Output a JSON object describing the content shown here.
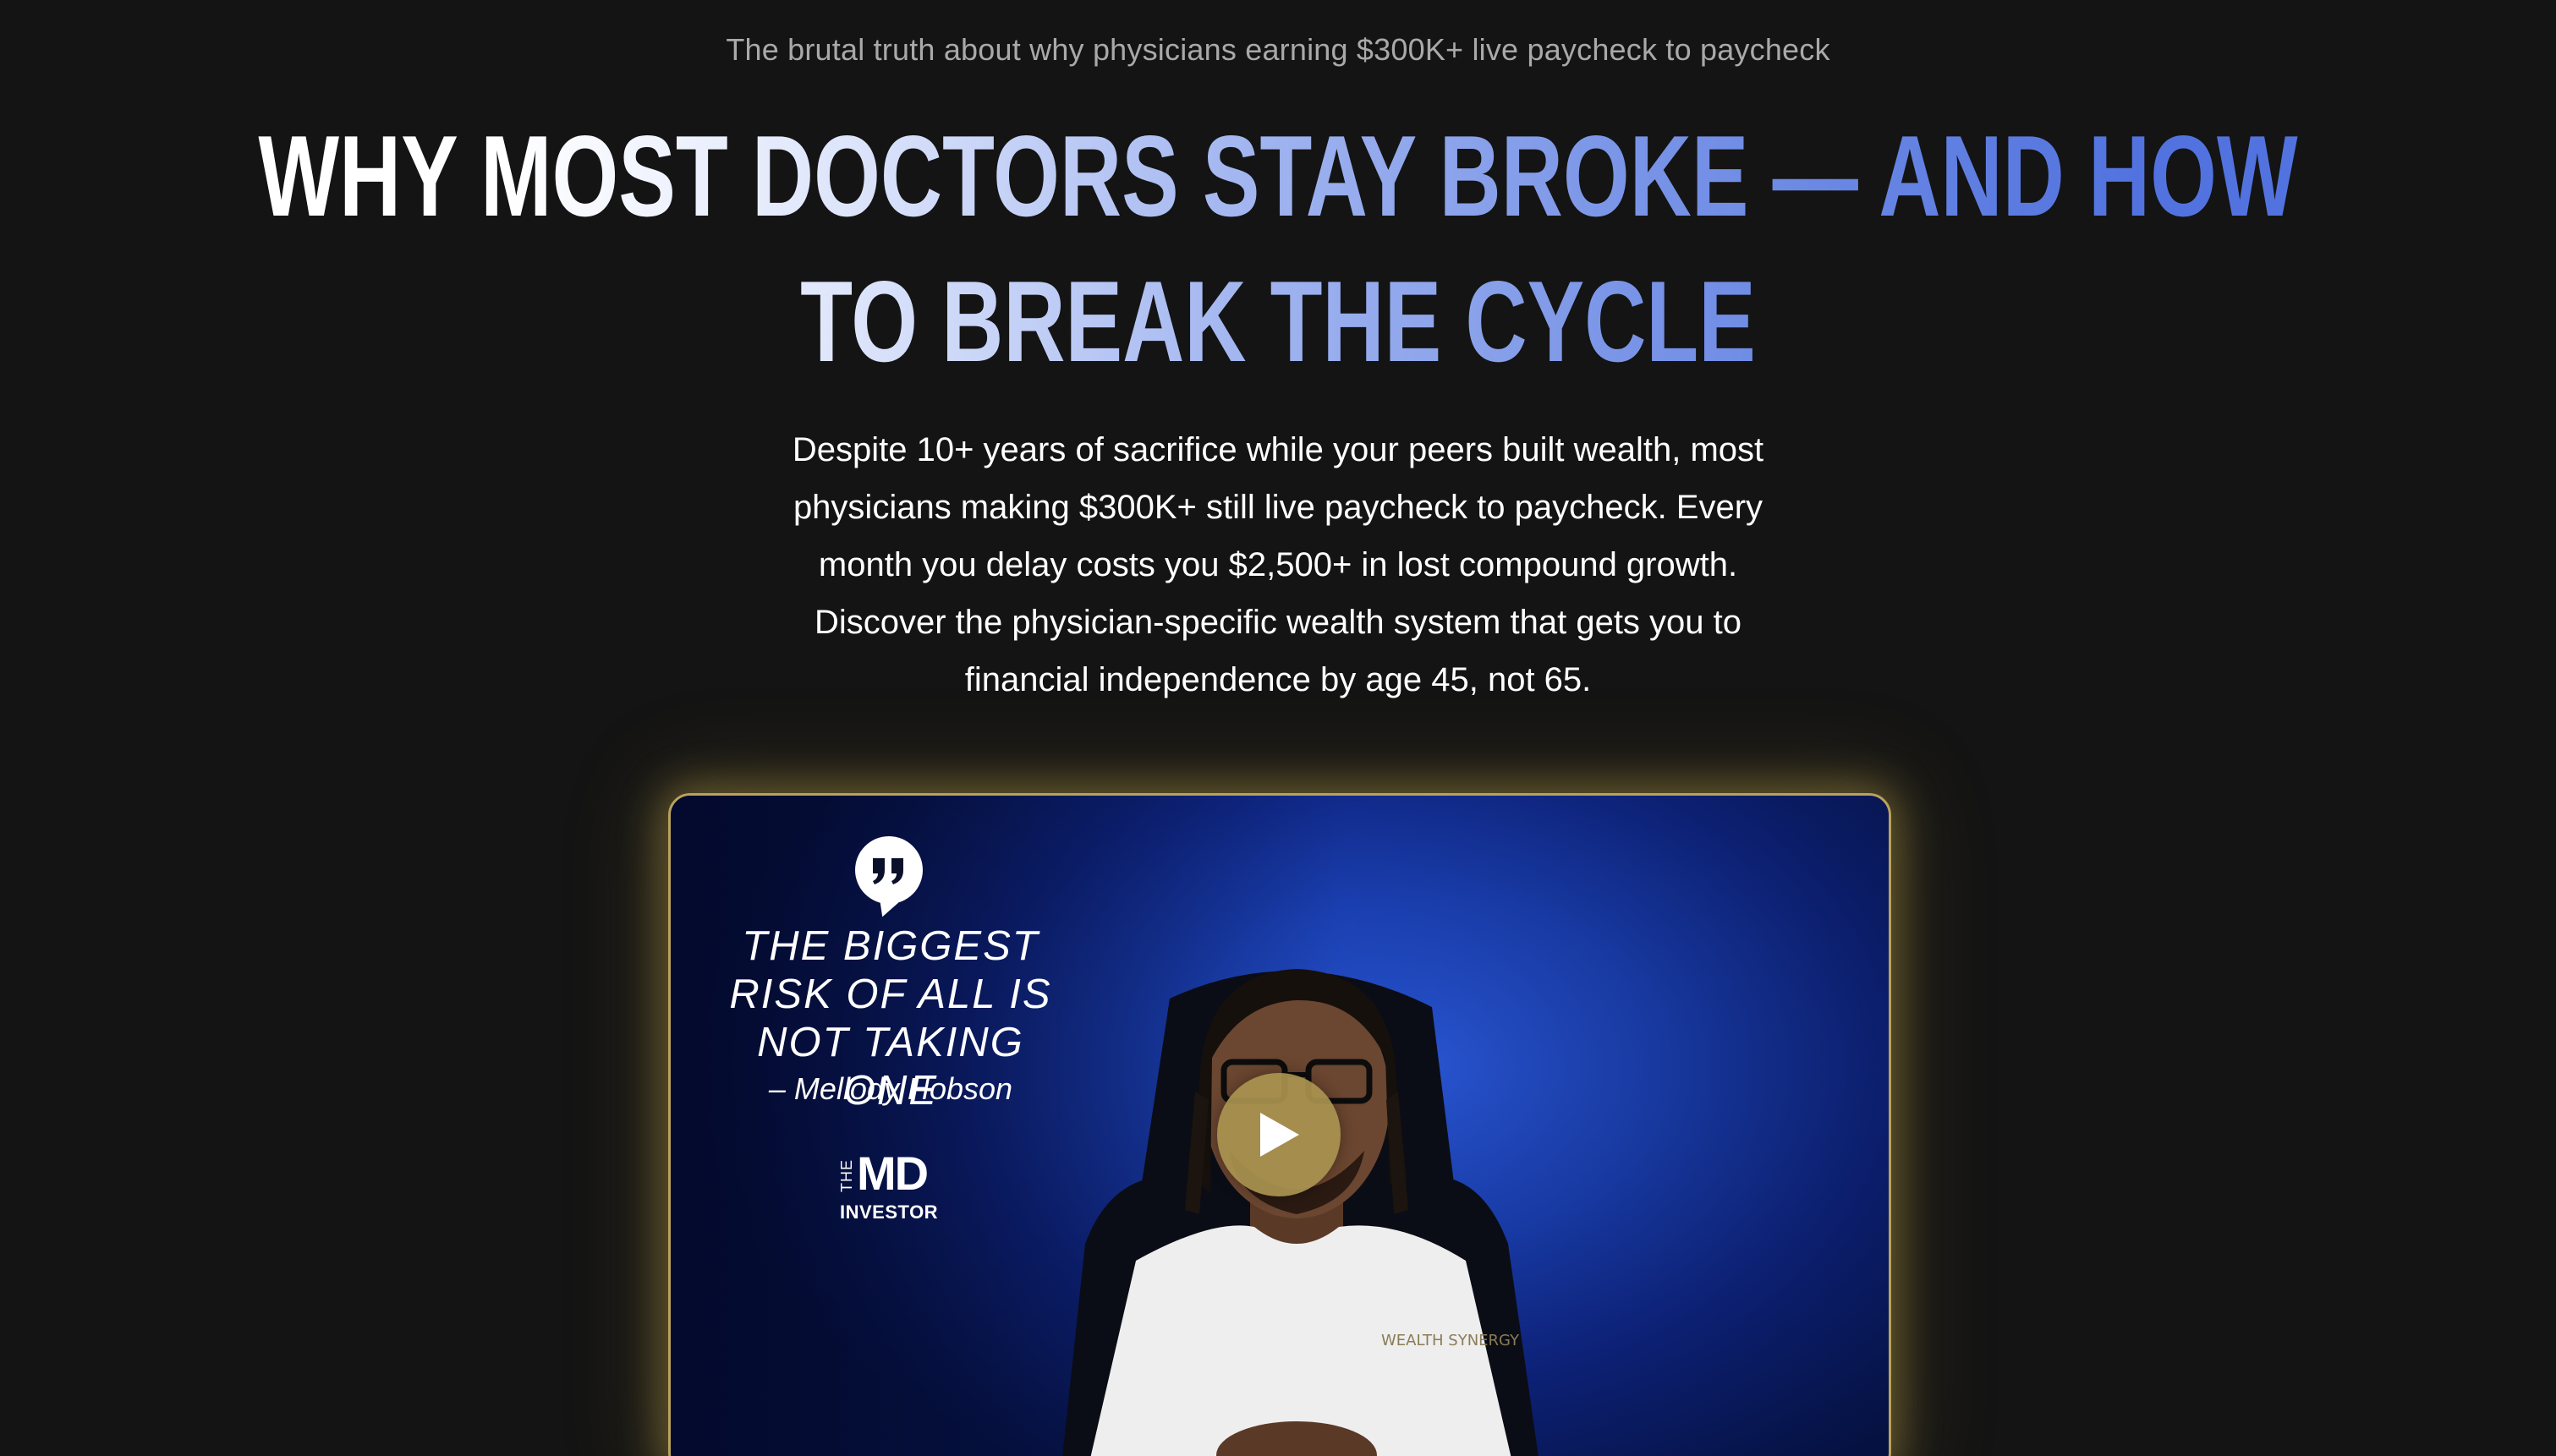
{
  "hero": {
    "eyebrow": "The brutal truth about why physicians earning $300K+ live paycheck to paycheck",
    "headline": "WHY MOST DOCTORS STAY BROKE — AND HOW TO BREAK THE CYCLE",
    "subtext": "Despite 10+ years of sacrifice while your peers built wealth, most physicians making $300K+ still live paycheck to paycheck. Every month you delay costs you $2,500+ in lost compound growth. Discover the physician-specific wealth system that gets you to financial independence by age 45, not 65."
  },
  "video": {
    "quote": "THE BIGGEST RISK OF ALL IS NOT TAKING ONE",
    "author": "– Mellody Hobson",
    "logo_the": "THE",
    "logo_md": "MD",
    "logo_investor": "INVESTOR",
    "shirt_text": "WEALTH SYNERGY",
    "play_icon": "play-icon",
    "quote_icon": "quote-icon"
  },
  "colors": {
    "background": "#141414",
    "headline_gradient_start": "#ffffff",
    "headline_gradient_end": "#5273df",
    "video_border": "#b8a25e",
    "play_button": "#aa9450"
  }
}
